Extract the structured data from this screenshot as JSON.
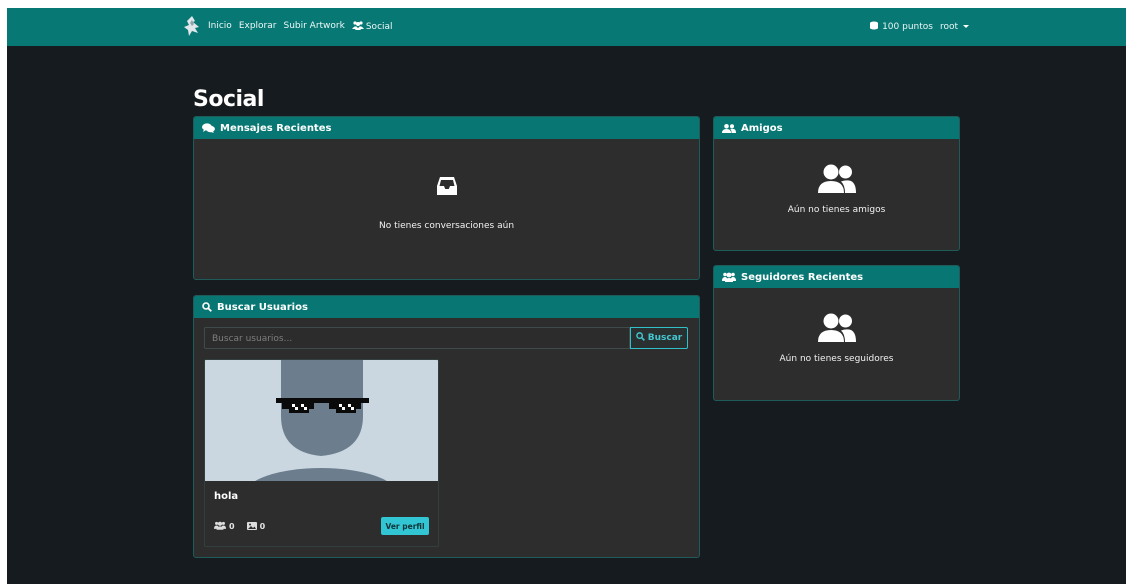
{
  "nav": {
    "links": [
      "Inicio",
      "Explorar",
      "Subir Artwork",
      "Social"
    ],
    "points": "100 puntos",
    "user": "root"
  },
  "page": {
    "title": "Social"
  },
  "messages": {
    "title": "Mensajes Recientes",
    "empty_text": "No tienes conversaciones aún"
  },
  "friends": {
    "title": "Amigos",
    "empty_text": "Aún no tienes amigos"
  },
  "followers": {
    "title": "Seguidores Recientes",
    "empty_text": "Aún no tienes seguidores"
  },
  "search": {
    "title": "Buscar Usuarios",
    "placeholder": "Buscar usuarios...",
    "button": "Buscar"
  },
  "user_card": {
    "name": "hola",
    "followers_count": "0",
    "artworks_count": "0",
    "button": "Ver perfil"
  },
  "colors": {
    "accent": "#077874",
    "background": "#161b20",
    "card": "#2d2d2d",
    "button_cyan": "#32c5d4"
  },
  "icons": {
    "logo": "hand-logo-icon",
    "social": "users-icon",
    "coins": "coins-icon",
    "messages": "comments-icon",
    "friends": "user-friends-icon",
    "followers": "users-icon",
    "search": "search-icon",
    "inbox": "inbox-icon",
    "image": "image-icon"
  }
}
